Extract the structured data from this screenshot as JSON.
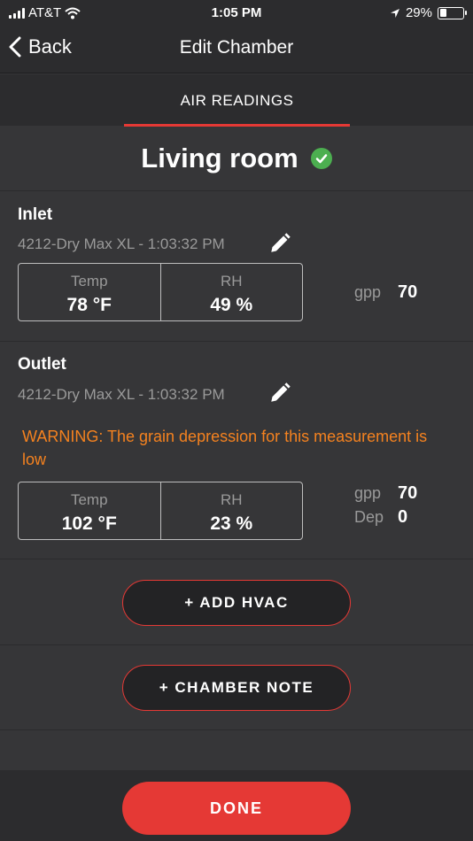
{
  "status_bar": {
    "carrier": "AT&T",
    "time": "1:05 PM",
    "battery": "29%",
    "battery_level": 0.29
  },
  "nav": {
    "back_label": "Back",
    "title": "Edit Chamber"
  },
  "tabs": [
    {
      "label": "AIR READINGS",
      "active": true
    }
  ],
  "room": {
    "name": "Living room"
  },
  "inlet": {
    "title": "Inlet",
    "device": "4212-Dry Max XL - 1:03:32 PM",
    "temp_label": "Temp",
    "temp_value": "78 °F",
    "rh_label": "RH",
    "rh_value": "49 %",
    "gpp_label": "gpp",
    "gpp_value": "70"
  },
  "outlet": {
    "title": "Outlet",
    "device": "4212-Dry Max XL - 1:03:32 PM",
    "warning": "WARNING: The grain depression for this measurement is low",
    "temp_label": "Temp",
    "temp_value": "102 °F",
    "rh_label": "RH",
    "rh_value": "23 %",
    "gpp_label": "gpp",
    "gpp_value": "70",
    "dep_label": "Dep",
    "dep_value": "0"
  },
  "buttons": {
    "add_hvac": "+ ADD HVAC",
    "chamber_note": "+ CHAMBER NOTE",
    "done": "DONE"
  },
  "colors": {
    "accent": "#e53935",
    "warning": "#f5821f",
    "success": "#4caf50",
    "background": "#363638"
  }
}
